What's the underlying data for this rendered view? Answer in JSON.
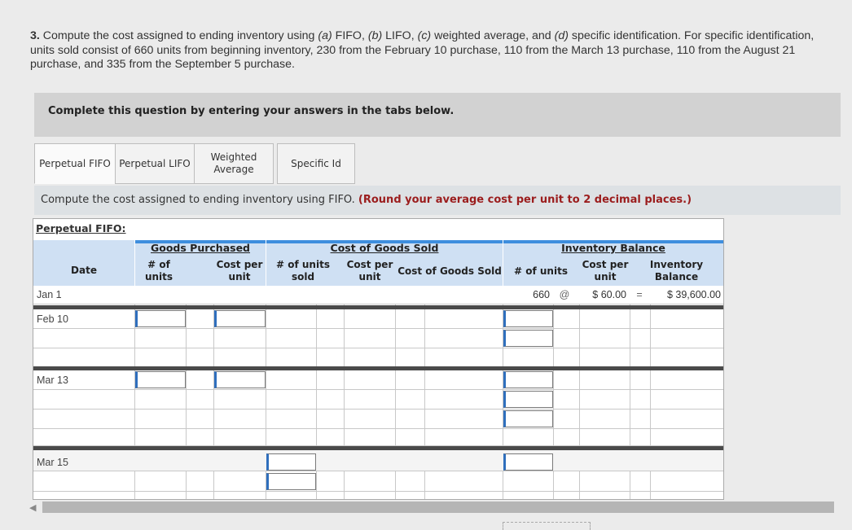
{
  "question": {
    "number": "3.",
    "text_a": "Compute the cost assigned to ending inventory using ",
    "part_a": "(a)",
    "fifo": "FIFO,",
    "part_b": "(b)",
    "lifo": "LIFO,",
    "part_c": "(c)",
    "wavg": "weighted average, and",
    "part_d": "(d)",
    "text_b": "specific identification. For specific identification, units sold consist of 660 units from beginning inventory, 230 from the February 10 purchase, 110 from the March 13 purchase, 110 from the August 21 purchase, and 335 from the September 5 purchase."
  },
  "banner": "Complete this question by entering your answers in the tabs below.",
  "tabs": [
    {
      "label": "Perpetual FIFO"
    },
    {
      "label": "Perpetual LIFO"
    },
    {
      "label": "Weighted Average"
    },
    {
      "label": "Specific Id"
    }
  ],
  "instruction": {
    "text": "Compute the cost assigned to ending inventory using FIFO.",
    "note": "(Round your average cost per unit to 2 decimal places.)"
  },
  "sheet": {
    "title": "Perpetual FIFO:",
    "groups": {
      "purchased": "Goods Purchased",
      "cogs": "Cost of Goods Sold",
      "balance": "Inventory Balance"
    },
    "headers": {
      "date": "Date",
      "p_units": "# of units",
      "p_cost": "Cost per unit",
      "s_units": "# of units sold",
      "s_cost": "Cost per unit",
      "s_total": "Cost of Goods Sold",
      "b_units": "# of units",
      "b_cost": "Cost per unit",
      "b_total": "Inventory Balance"
    },
    "rows": {
      "jan1": {
        "date": "Jan 1",
        "units": "660",
        "at": "@",
        "cost": "$ 60.00",
        "eq": "=",
        "total": "$ 39,600.00"
      },
      "feb10": {
        "date": "Feb 10"
      },
      "mar13": {
        "date": "Mar 13"
      },
      "mar15": {
        "date": "Mar 15"
      }
    }
  }
}
